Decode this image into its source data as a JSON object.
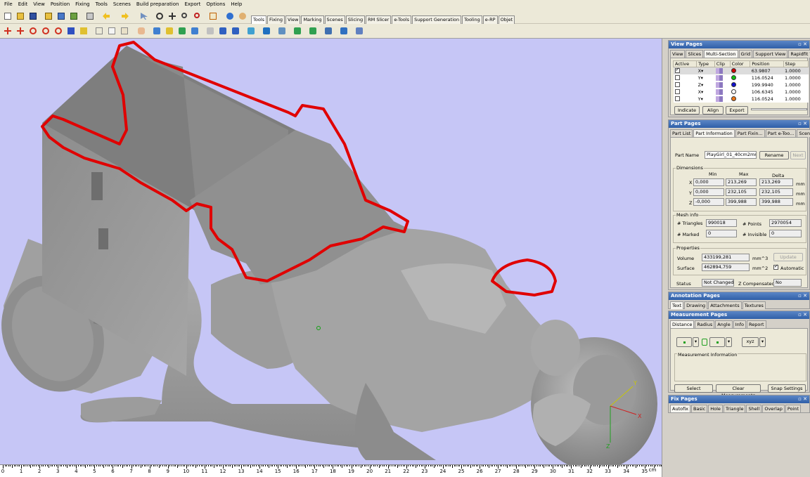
{
  "menu": [
    "File",
    "Edit",
    "View",
    "Position",
    "Fixing",
    "Tools",
    "Scenes",
    "Build preparation",
    "Export",
    "Options",
    "Help"
  ],
  "ribbon_tabs": [
    "Tools",
    "Fixing",
    "View",
    "Marking",
    "Scenes",
    "Slicing",
    "RM Slicer",
    "e-Tools",
    "Support Generation",
    "Tooling",
    "e-RP",
    "Objet"
  ],
  "ribbon_active": "Tools",
  "ruler": {
    "unit": "cm",
    "labels": [
      "0",
      "1",
      "2",
      "3",
      "4",
      "5",
      "6",
      "7",
      "8",
      "9",
      "10",
      "11",
      "12",
      "13",
      "14",
      "15",
      "16",
      "17",
      "18",
      "19",
      "20",
      "21",
      "22",
      "23",
      "24",
      "25",
      "26",
      "27",
      "28",
      "29",
      "30",
      "31",
      "32",
      "33",
      "34",
      "35"
    ]
  },
  "axis_labels": {
    "x": "X",
    "y": "Y",
    "z": "Z"
  },
  "view_pages": {
    "title": "View Pages",
    "tabs": [
      "View",
      "Slices",
      "Multi-Section",
      "Grid",
      "Support View",
      "Rapidfit View"
    ],
    "active_tab": "Multi-Section",
    "columns": [
      "Active",
      "Type",
      "Clip",
      "Color",
      "Position",
      "Step"
    ],
    "rows": [
      {
        "active": true,
        "type": "X",
        "color": "#d00000",
        "position": "63.9807",
        "step": "1.0000"
      },
      {
        "active": false,
        "type": "Y",
        "color": "#10c010",
        "position": "116.0524",
        "step": "1.0000"
      },
      {
        "active": false,
        "type": "Z",
        "color": "#1010d0",
        "position": "199.9940",
        "step": "1.0000"
      },
      {
        "active": false,
        "type": "X",
        "color": "#ffffff",
        "position": "106.6345",
        "step": "1.0000"
      },
      {
        "active": false,
        "type": "Y",
        "color": "#f07818",
        "position": "116.0524",
        "step": "1.0000"
      }
    ],
    "buttons": [
      "Indicate",
      "Align",
      "Export"
    ]
  },
  "part_pages": {
    "title": "Part Pages",
    "tabs": [
      "Part List",
      "Part Information",
      "Part Fixin...",
      "Part e-Too...",
      "Scenes"
    ],
    "active_tab": "Part Information",
    "part_name_label": "Part Name",
    "part_name": "PlayGirl_01_40cm2mm",
    "rename": "Rename",
    "next": "Next",
    "dimensions_title": "Dimensions",
    "dim_headers": [
      "Min",
      "Max",
      "Delta"
    ],
    "dims": [
      {
        "axis": "X",
        "min": "0,000",
        "max": "213,269",
        "delta": "213,269",
        "unit": "mm"
      },
      {
        "axis": "Y",
        "min": "0,000",
        "max": "232,105",
        "delta": "232,105",
        "unit": "mm"
      },
      {
        "axis": "Z",
        "min": "-0,000",
        "max": "399,988",
        "delta": "399,988",
        "unit": "mm"
      }
    ],
    "mesh_title": "Mesh info",
    "triangles_label": "# Triangles",
    "triangles": "990018",
    "points_label": "# Points",
    "points": "2970054",
    "marked_label": "# Marked",
    "marked": "0",
    "invisible_label": "# Invisible",
    "invisible": "0",
    "props_title": "Properties",
    "volume_label": "Volume",
    "volume": "433199,281",
    "volume_unit": "mm^3",
    "surface_label": "Surface",
    "surface": "462894,759",
    "surface_unit": "mm^2",
    "update": "Update",
    "automatic": "Automatic",
    "status_label": "Status",
    "status": "Not Changed",
    "zcomp_label": "Z Compensated",
    "zcomp": "No"
  },
  "annotation_pages": {
    "title": "Annotation Pages",
    "tabs": [
      "Text",
      "Drawing",
      "Attachments",
      "Textures"
    ],
    "active_tab": "Text"
  },
  "measurement_pages": {
    "title": "Measurement Pages",
    "tabs": [
      "Distance",
      "Radius",
      "Angle",
      "Info",
      "Report"
    ],
    "active_tab": "Distance",
    "xyz": "xyz",
    "info_title": "Measurement Information",
    "buttons": [
      "Select",
      "Clear Measurements",
      "Snap Settings"
    ]
  },
  "fix_pages": {
    "title": "Fix Pages",
    "tabs": [
      "Autofix",
      "Basic",
      "Hole",
      "Triangle",
      "Shell",
      "Overlap",
      "Point"
    ],
    "active_tab": "Autofix"
  },
  "colors": {
    "viewport_bg": "#c6c6f6",
    "section_line": "#e00000",
    "model": "#9a9a9a"
  }
}
